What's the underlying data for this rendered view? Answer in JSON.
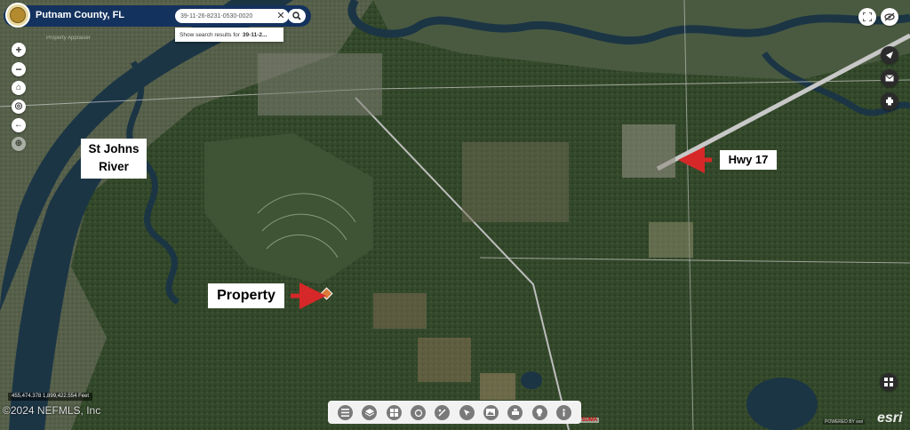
{
  "header": {
    "title": "Putnam County, FL",
    "subtitle": "Property Appraiser"
  },
  "search": {
    "value": "39-11-26-8231-0530-0020",
    "clear_glyph": "✕",
    "suggestion_prefix": "Show search results for",
    "suggestion_bold": "39-11-2..."
  },
  "toolbar_left": {
    "zoom_in": "+",
    "zoom_out": "−",
    "home": "⌂",
    "locate": "◎",
    "back": "←",
    "extra": "⊕"
  },
  "annotations": {
    "river_line1": "St Johns",
    "river_line2": "River",
    "highway": "Hwy 17",
    "property": "Property"
  },
  "footer": {
    "coordinates": "455,474.378 1,899,422.554 Feet",
    "copyright": "©2024 NEFMLS, Inc",
    "place_label": "SATSUMA",
    "attribution": "POWERED BY esri",
    "esri_logo": "esri"
  },
  "colors": {
    "header_bg": "#14325e",
    "arrow": "#d62828",
    "river": "#1b3545",
    "forest": "#2f4526"
  },
  "icons": [
    "seal-icon",
    "search-icon",
    "fullscreen-icon",
    "visibility-icon",
    "share-icon",
    "mail-icon",
    "print-icon",
    "basemap-icon",
    "layers-icon",
    "list-icon",
    "grid-icon",
    "info-icon"
  ]
}
